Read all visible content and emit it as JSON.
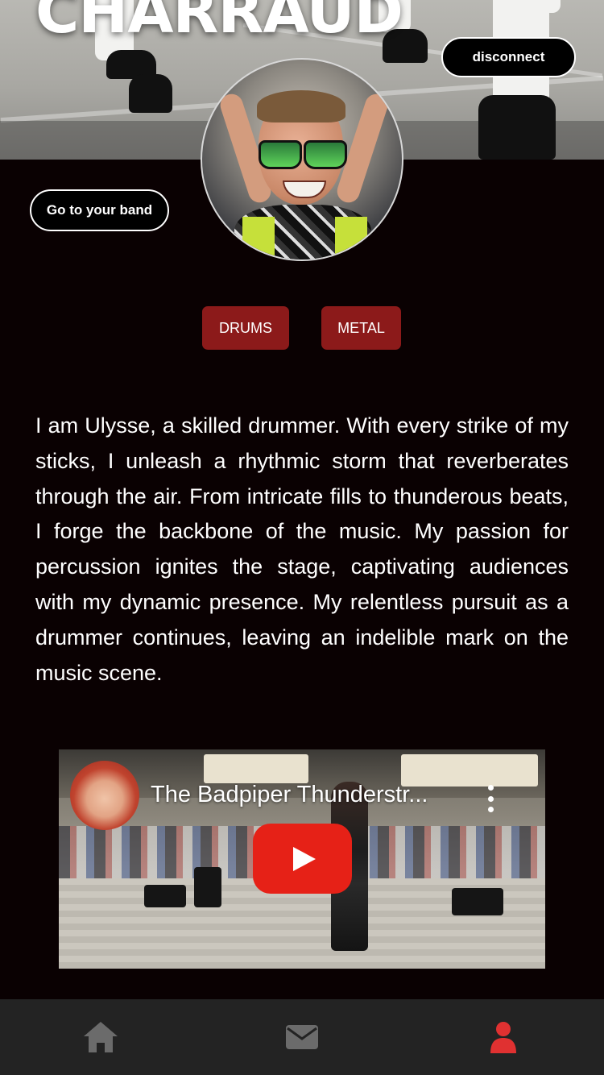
{
  "profile": {
    "name": "CHARRAUD",
    "disconnect_label": "disconnect",
    "band_label": "Go to your band",
    "tags": [
      "DRUMS",
      "METAL"
    ],
    "bio": "I am Ulysse, a skilled drummer. With every strike of my sticks, I unleash a rhythmic storm that reverberates through the air. From intricate fills to thunderous beats, I forge the backbone of the music. My passion for percussion ignites the stage, captivating audiences with my dynamic presence. My relentless pursuit as a drummer continues, leaving an indelible mark on the music scene."
  },
  "video": {
    "title": "The Badpiper Thunderstr..."
  },
  "nav": {
    "items": [
      {
        "icon": "home-icon",
        "active": false
      },
      {
        "icon": "mail-icon",
        "active": false
      },
      {
        "icon": "user-icon",
        "active": true
      }
    ]
  },
  "colors": {
    "background": "#0a0102",
    "tag": "#8c1a1a",
    "nav_bg": "#232323",
    "nav_icon": "#6b6b6b",
    "nav_active": "#e03131",
    "play_button": "#e62117"
  }
}
